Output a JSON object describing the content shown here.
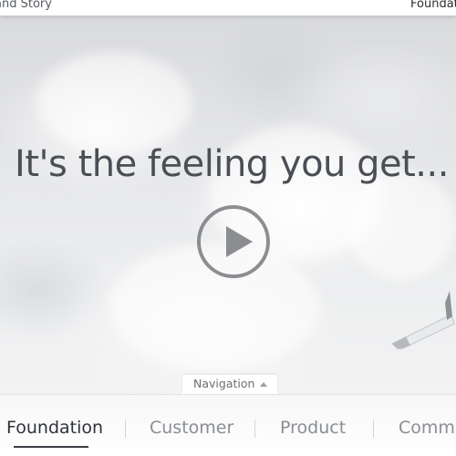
{
  "header": {
    "left_link": "and Story",
    "right_link": "Foundati"
  },
  "hero": {
    "headline": "It's the feeling you get...",
    "play_icon": "play-circle-icon",
    "nav_toggle_label": "Navigation",
    "nav_toggle_icon": "caret-up-icon"
  },
  "bottom_nav": {
    "items": [
      {
        "label": "Foundation",
        "active": true
      },
      {
        "label": "Customer",
        "active": false
      },
      {
        "label": "Product",
        "active": false
      },
      {
        "label": "Commu",
        "active": false
      }
    ]
  },
  "colors": {
    "headline": "#4b4f55",
    "active_nav": "#2f3338",
    "inactive_nav": "#8a8e93"
  }
}
